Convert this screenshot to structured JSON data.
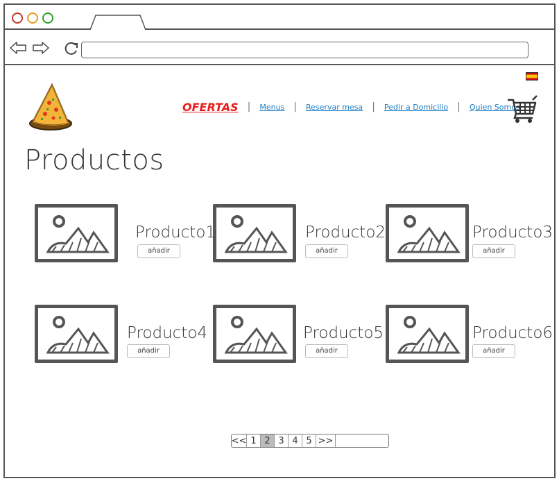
{
  "browser": {
    "controls": [
      "close",
      "minimize",
      "maximize"
    ],
    "url": ""
  },
  "header": {
    "language_flag": "spain-flag-icon",
    "logo": "pizza-slice-logo",
    "menu": {
      "ofertas": "OFERTAS",
      "items": [
        "Menus",
        "Reservar mesa",
        "Pedir a Domicilio",
        "Quien Somos"
      ]
    },
    "cart_icon": "shopping-cart-icon"
  },
  "page_title": "Productos",
  "products": [
    {
      "name": "Producto1",
      "button": "añadir"
    },
    {
      "name": "Producto2",
      "button": "añadir"
    },
    {
      "name": "Producto3",
      "button": "añadir"
    },
    {
      "name": "Producto4",
      "button": "añadir"
    },
    {
      "name": "Producto5",
      "button": "añadir"
    },
    {
      "name": "Producto6",
      "button": "añadir"
    }
  ],
  "pagination": {
    "first": "<<",
    "pages": [
      "1",
      "2",
      "3",
      "4",
      "5"
    ],
    "current": "2",
    "last": ">>"
  },
  "colors": {
    "ofertas": "#e81c1c",
    "link": "#1a7cc2",
    "frame": "#555555"
  }
}
